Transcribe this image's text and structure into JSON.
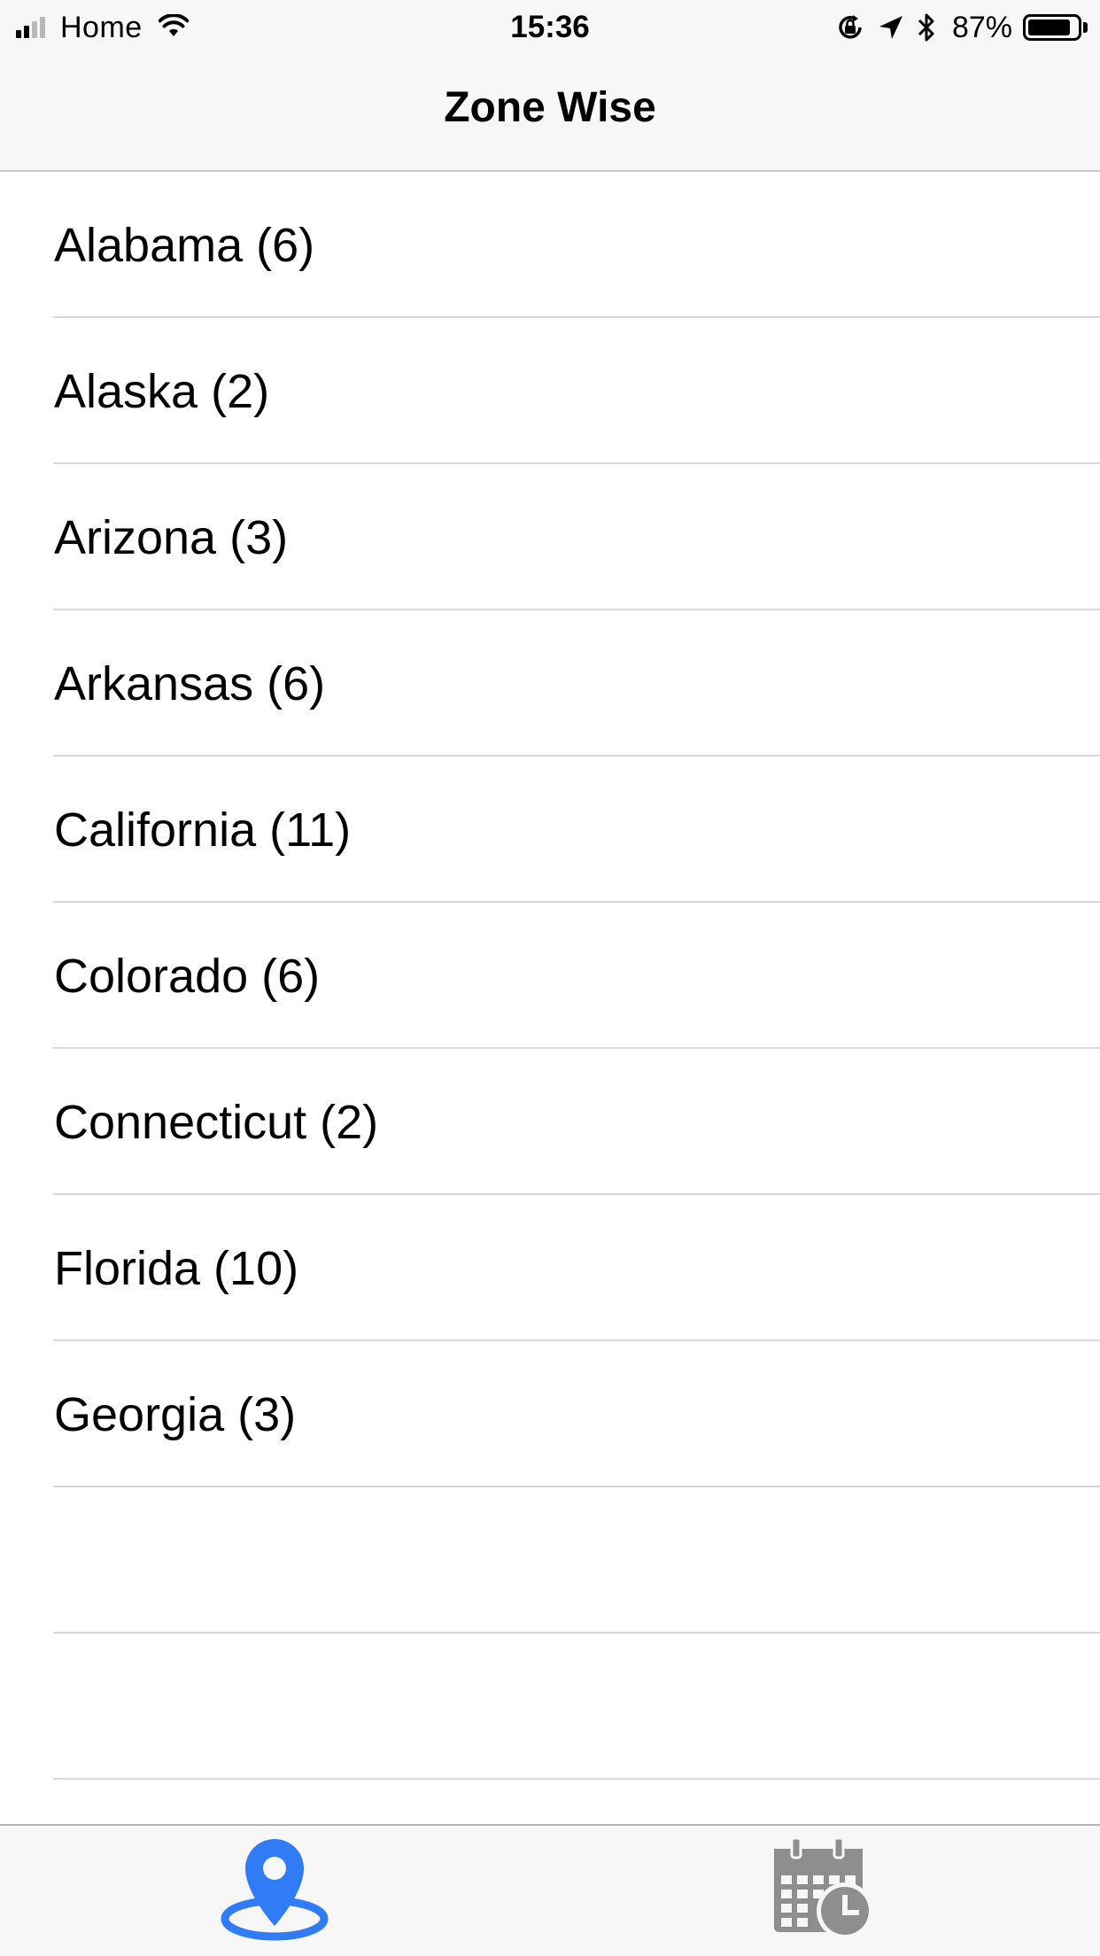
{
  "status_bar": {
    "carrier": "Home",
    "time": "15:36",
    "battery_percent": "87%",
    "battery_level": 0.87,
    "signal_bars_filled": 2,
    "signal_bars_total": 4,
    "icons": [
      "signal-icon",
      "wifi-icon",
      "orientation-lock-icon",
      "location-arrow-icon",
      "bluetooth-icon",
      "battery-icon"
    ]
  },
  "nav": {
    "title": "Zone Wise"
  },
  "zones": [
    {
      "label": "Alabama (6)"
    },
    {
      "label": "Alaska (2)"
    },
    {
      "label": "Arizona (3)"
    },
    {
      "label": "Arkansas (6)"
    },
    {
      "label": "California (11)"
    },
    {
      "label": "Colorado (6)"
    },
    {
      "label": "Connecticut (2)"
    },
    {
      "label": "Florida (10)"
    },
    {
      "label": "Georgia (3)"
    },
    {
      "label": ""
    },
    {
      "label": ""
    }
  ],
  "tabbar": {
    "tabs": [
      {
        "icon": "map-pin-icon",
        "selected": true
      },
      {
        "icon": "calendar-clock-icon",
        "selected": false
      }
    ]
  },
  "colors": {
    "accent": "#2f7cf6",
    "inactive_tab": "#8e8e8e",
    "separator": "#d9d9dd",
    "bar_background": "#f7f7f7"
  }
}
